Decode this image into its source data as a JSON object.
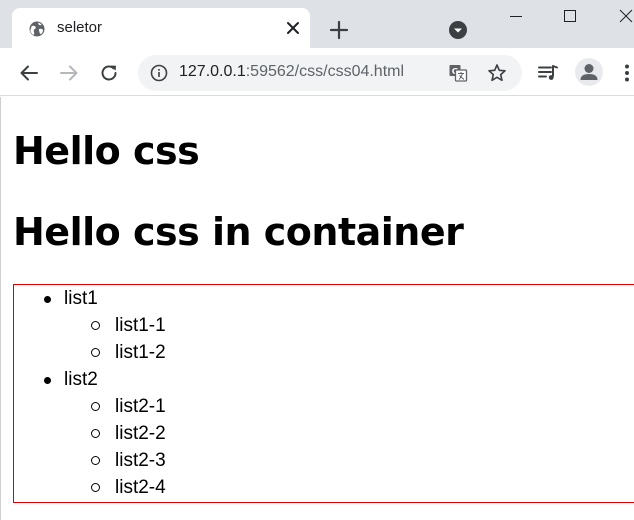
{
  "browser": {
    "tab_title": "seletor",
    "url_host": "127.0.0.1",
    "url_path": ":59562/css/css04.html"
  },
  "page": {
    "heading1": "Hello css",
    "heading2": "Hello css in container",
    "list": [
      {
        "label": "list1",
        "children": [
          "list1-1",
          "list1-2"
        ]
      },
      {
        "label": "list2",
        "children": [
          "list2-1",
          "list2-2",
          "list2-3",
          "list2-4"
        ]
      }
    ]
  },
  "colors": {
    "container_border": "#e00000",
    "tabstrip_bg": "#dee1e6",
    "omnibox_bg": "#f1f3f4"
  },
  "icons": [
    "globe-icon",
    "close-icon",
    "plus-icon",
    "tab-search-icon",
    "minimize-icon",
    "maximize-icon",
    "window-close-icon",
    "back-arrow-icon",
    "forward-arrow-icon",
    "reload-icon",
    "info-icon",
    "translate-icon",
    "star-icon",
    "reading-list-icon",
    "profile-icon",
    "more-vert-icon"
  ]
}
